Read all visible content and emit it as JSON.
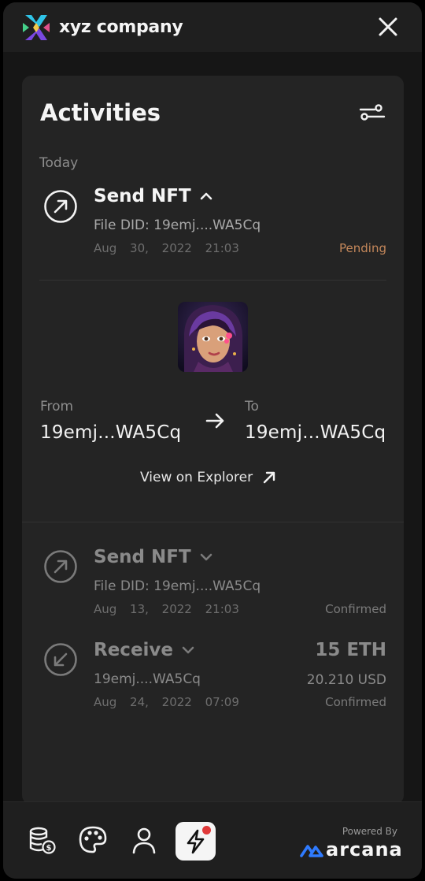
{
  "app": {
    "name": "xyz company"
  },
  "colors": {
    "accent_blue": "#2f7bff",
    "pending": "#c4875a",
    "confirmed": "#7a7a7a",
    "badge_red": "#e03a3a"
  },
  "activities": {
    "title": "Activities",
    "section_today": "Today",
    "items": [
      {
        "title": "Send NFT",
        "direction": "send",
        "expanded": true,
        "subtitle": "File DID: 19emj....WA5Cq",
        "date": "Aug 30, 2022",
        "time": "21:03",
        "status": "Pending",
        "details": {
          "from_label": "From",
          "from_value": "19emj...WA5Cq",
          "to_label": "To",
          "to_value": "19emj...WA5Cq",
          "explorer_link": "View on Explorer"
        }
      },
      {
        "title": "Send NFT",
        "direction": "send",
        "expanded": false,
        "subtitle": "File DID: 19emj....WA5Cq",
        "date": "Aug 13, 2022",
        "time": "21:03",
        "status": "Confirmed"
      },
      {
        "title": "Receive",
        "direction": "receive",
        "expanded": false,
        "subtitle": "19emj....WA5Cq",
        "date": "Aug 24, 2022",
        "time": "07:09",
        "amount": "15 ETH",
        "amount_usd": "20.210 USD",
        "status": "Confirmed"
      }
    ]
  },
  "footer": {
    "nav": [
      {
        "icon": "coins-dollar-icon"
      },
      {
        "icon": "palette-icon"
      },
      {
        "icon": "user-icon"
      },
      {
        "icon": "lightning-icon",
        "active": true
      }
    ],
    "powered_by": "Powered By",
    "brand": "arcana"
  }
}
